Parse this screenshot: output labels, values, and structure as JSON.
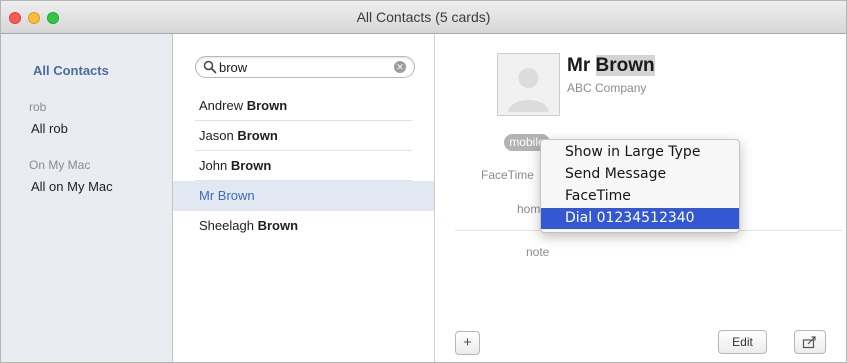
{
  "window": {
    "title": "All Contacts (5 cards)"
  },
  "groups": {
    "all_contacts": "All Contacts",
    "sections": [
      {
        "header": "rob",
        "item": "All rob"
      },
      {
        "header": "On My Mac",
        "item": "All on My Mac"
      }
    ]
  },
  "search": {
    "value": "brow"
  },
  "contacts": [
    {
      "first": "Andrew",
      "last": "Brown"
    },
    {
      "first": "Jason",
      "last": "Brown"
    },
    {
      "first": "John",
      "last": "Brown"
    },
    {
      "first": "Mr",
      "last": "Brown",
      "selected": true
    },
    {
      "first": "Sheelagh",
      "last": "Brown"
    }
  ],
  "card": {
    "prefix": "Mr",
    "last": "Brown",
    "company": "ABC Company",
    "phone_label": "mobile",
    "facetime_label": "FaceTime",
    "home_label": "home",
    "note_label": "note"
  },
  "buttons": {
    "add": "+",
    "edit": "Edit"
  },
  "context_menu": {
    "items": [
      "Show in Large Type",
      "Send Message",
      "FaceTime",
      "Dial 01234512340"
    ],
    "highlighted_index": 3
  },
  "colors": {
    "accent_selected_text": "#3c6cb7",
    "selection_bg": "#e2e8f1",
    "menu_highlight": "#3458d3",
    "sidebar_bg": "#e9edf2"
  }
}
